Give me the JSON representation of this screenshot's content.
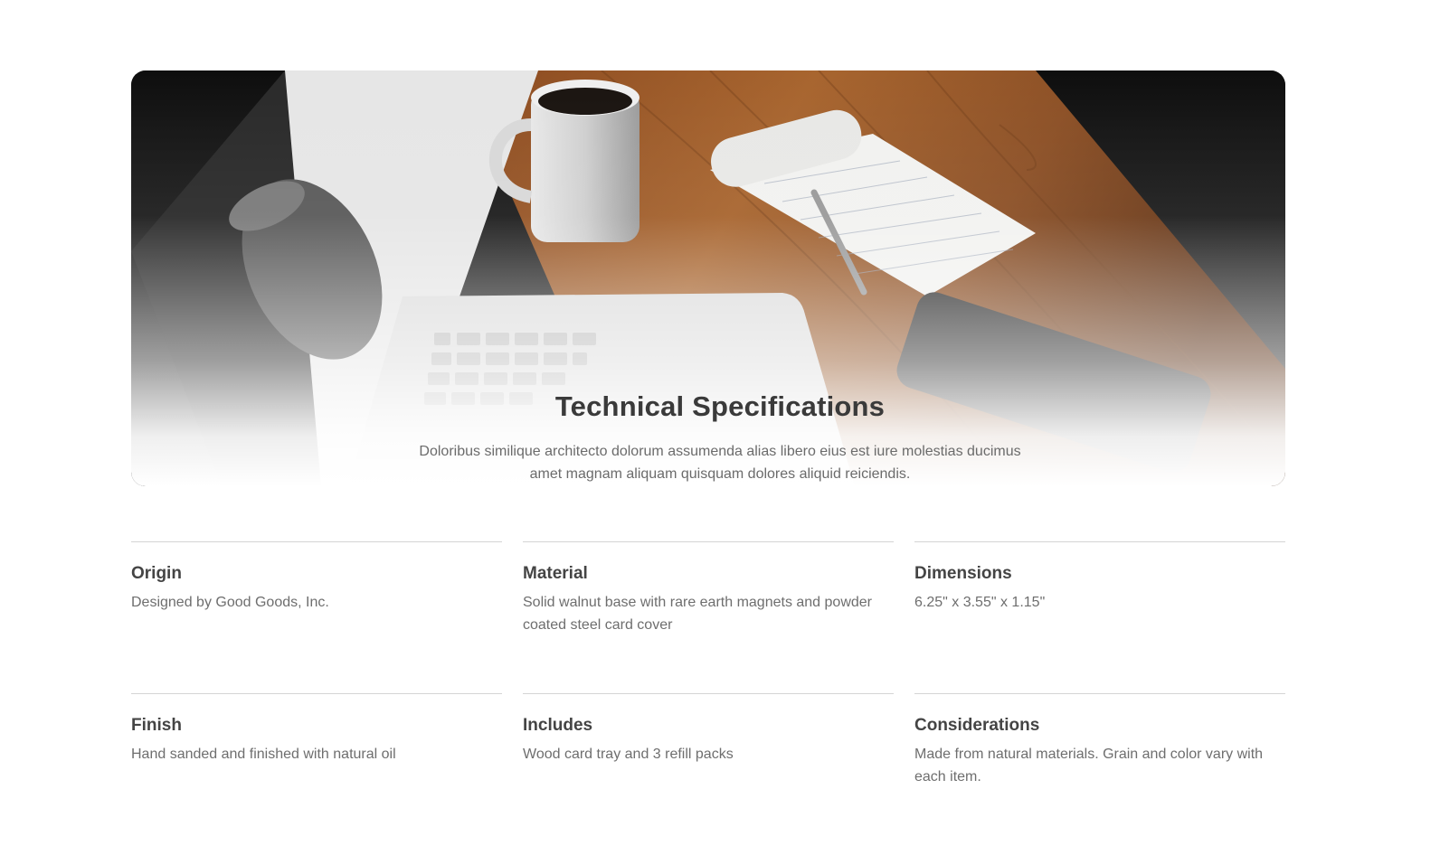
{
  "hero": {
    "image_alt": "Desk with laptop, coffee mug, notepad with pen, and phone on walnut wood surface",
    "title": "Technical Specifications",
    "description": "Doloribus similique architecto dolorum assumenda alias libero eius est iure molestias ducimus amet magnam aliquam quisquam dolores aliquid reiciendis."
  },
  "specs": [
    {
      "title": "Origin",
      "description": "Designed by Good Goods, Inc."
    },
    {
      "title": "Material",
      "description": "Solid walnut base with rare earth magnets and powder coated steel card cover"
    },
    {
      "title": "Dimensions",
      "description": "6.25\" x 3.55\" x 1.15\""
    },
    {
      "title": "Finish",
      "description": "Hand sanded and finished with natural oil"
    },
    {
      "title": "Includes",
      "description": "Wood card tray and 3 refill packs"
    },
    {
      "title": "Considerations",
      "description": "Made from natural materials. Grain and color vary with each item."
    }
  ],
  "colors": {
    "heading": "#3a3a3a",
    "body_text": "#6e6e6e",
    "divider": "#d4d4d4",
    "wood": "#9a5a2c"
  }
}
